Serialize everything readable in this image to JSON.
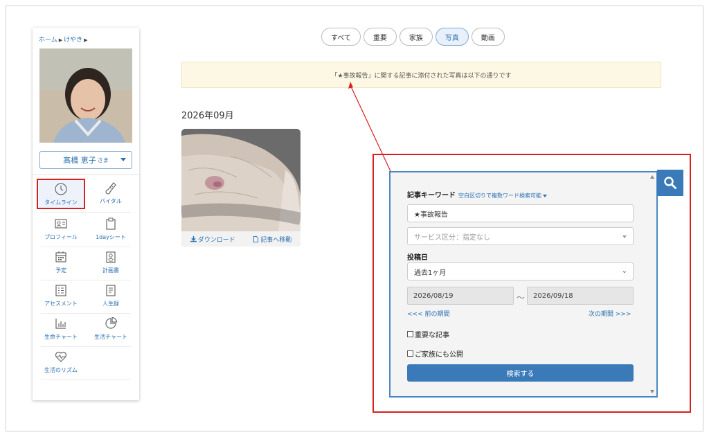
{
  "breadcrumb": {
    "home": "ホーム",
    "facility": "けやき"
  },
  "resident": {
    "name": "高橋 恵子",
    "suffix": "さま"
  },
  "nav": {
    "timeline": "タイムライン",
    "vital": "バイタル",
    "profile": "プロフィール",
    "oneday_sheet": "1dayシート",
    "schedule": "予定",
    "plan": "計画書",
    "assessment": "アセスメント",
    "life_record": "人生録",
    "life_chart": "生命チャート",
    "living_chart": "生活チャート",
    "life_rhythm": "生活のリズム"
  },
  "tabs": [
    "すべて",
    "重要",
    "家族",
    "写真",
    "動画"
  ],
  "active_tab": "写真",
  "notice": "「★事故報告」に関する記事に添付された写真は以下の通りです",
  "month_heading": "2026年09月",
  "card": {
    "download": "ダウンロード",
    "goto_article": "記事へ移動"
  },
  "search": {
    "keyword_label": "記事キーワード",
    "keyword_hint": "空白区切りで複数ワード検索可能",
    "keyword_value": "★事故報告",
    "service_placeholder": "サービス区分：指定なし",
    "post_date_label": "投稿日",
    "period_value": "過去1ヶ月",
    "date_from": "2026/08/19",
    "date_to": "2026/09/18",
    "tilde": "～",
    "prev_period": "<<< 前の期間",
    "next_period": "次の期間 >>>",
    "important_label": "重要な記事",
    "family_label": "ご家族にも公開",
    "submit_label": "検索する"
  },
  "colors": {
    "accent": "#3a7ab8",
    "annotation": "#d82020",
    "notice_bg": "#fcf8e3"
  }
}
